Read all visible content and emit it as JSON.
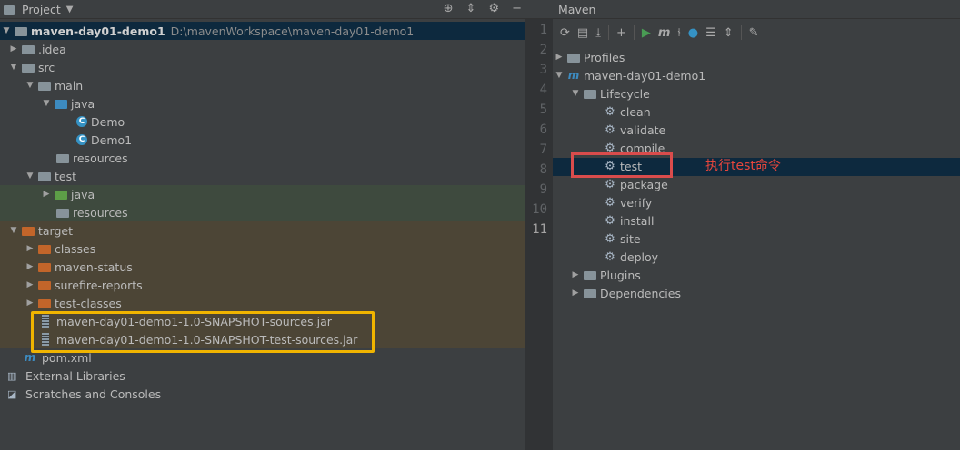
{
  "project_panel": {
    "title": "Project",
    "root": {
      "name": "maven-day01-demo1",
      "path": "D:\\mavenWorkspace\\maven-day01-demo1"
    },
    "items": [
      {
        "label": ".idea"
      },
      {
        "label": "src"
      },
      {
        "label": "main"
      },
      {
        "label": "java"
      },
      {
        "label": "Demo"
      },
      {
        "label": "Demo1"
      },
      {
        "label": "resources"
      },
      {
        "label": "test"
      },
      {
        "label": "java"
      },
      {
        "label": "resources"
      },
      {
        "label": "target"
      },
      {
        "label": "classes"
      },
      {
        "label": "maven-status"
      },
      {
        "label": "surefire-reports"
      },
      {
        "label": "test-classes"
      },
      {
        "label": "maven-day01-demo1-1.0-SNAPSHOT-sources.jar"
      },
      {
        "label": "maven-day01-demo1-1.0-SNAPSHOT-test-sources.jar"
      },
      {
        "label": "pom.xml"
      },
      {
        "label": "External Libraries"
      },
      {
        "label": "Scratches and Consoles"
      }
    ],
    "highlight_color": "#f0b400"
  },
  "gutter": {
    "lines": [
      "1",
      "2",
      "3",
      "4",
      "5",
      "6",
      "7",
      "8",
      "9",
      "10",
      "11"
    ]
  },
  "maven_panel": {
    "title": "Maven",
    "tree": [
      {
        "label": "Profiles"
      },
      {
        "label": "maven-day01-demo1"
      },
      {
        "label": "Lifecycle"
      },
      {
        "label": "clean"
      },
      {
        "label": "validate"
      },
      {
        "label": "compile"
      },
      {
        "label": "test"
      },
      {
        "label": "package"
      },
      {
        "label": "verify"
      },
      {
        "label": "install"
      },
      {
        "label": "site"
      },
      {
        "label": "deploy"
      },
      {
        "label": "Plugins"
      },
      {
        "label": "Dependencies"
      }
    ],
    "annotation": "执行test命令",
    "annotation_color": "#e8463c"
  }
}
